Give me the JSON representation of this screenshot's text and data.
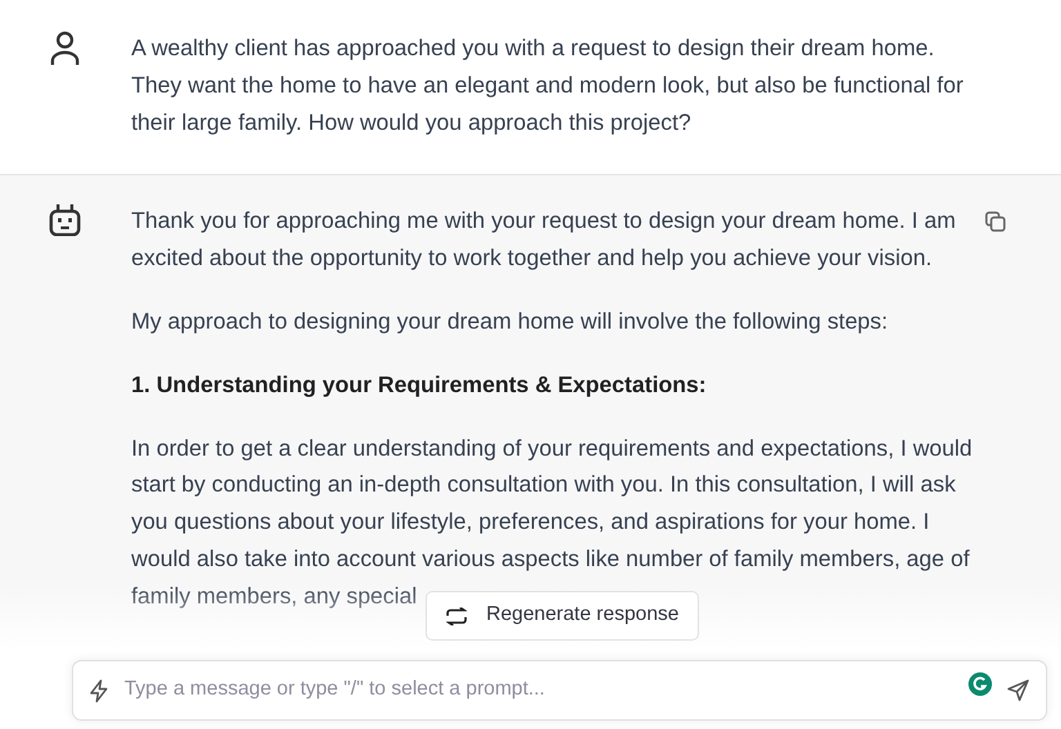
{
  "conversation": [
    {
      "kind": "user",
      "blocks": [
        {
          "kind": "paragraph",
          "lines": [
            "A wealthy client has approached you with a request to design their dream home.",
            "They want the home to have an elegant and modern look, but also be functional for",
            "their large family. How would you approach this project?"
          ]
        }
      ]
    },
    {
      "kind": "assistant",
      "blocks": [
        {
          "kind": "paragraph",
          "lines": [
            "Thank you for approaching me with your request to design your dream home. I am",
            "excited about the opportunity to work together and help you achieve your vision."
          ]
        },
        {
          "kind": "paragraph",
          "lines": [
            "My approach to designing your dream home will involve the following steps:"
          ]
        },
        {
          "kind": "heading",
          "lines": [
            "1. Understanding your Requirements & Expectations:"
          ]
        },
        {
          "kind": "paragraph",
          "lines": [
            "In order to get a clear understanding of your requirements and expectations, I would",
            "start by conducting an in-depth consultation with you. In this consultation, I will ask",
            "you questions about your lifestyle, preferences, and aspirations for your home. I",
            "would also take into account various aspects like number of family members, age of",
            "family members, any special"
          ]
        }
      ]
    }
  ],
  "regenerate_button": {
    "label": "Regenerate response"
  },
  "composer": {
    "placeholder": "Type a message or type \"/\" to select a prompt..."
  }
}
